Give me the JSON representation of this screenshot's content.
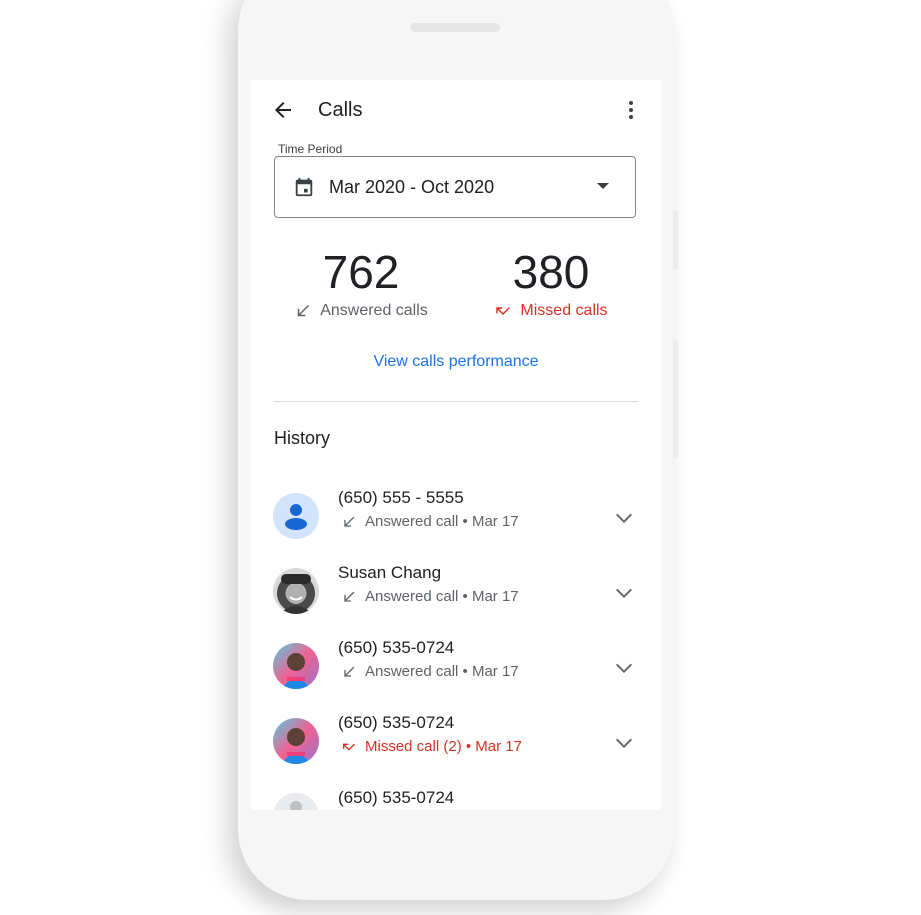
{
  "appbar": {
    "title": "Calls"
  },
  "time_period": {
    "label": "Time Period",
    "value": "Mar 2020 - Oct 2020"
  },
  "stats": {
    "answered": {
      "count": "762",
      "label": "Answered calls"
    },
    "missed": {
      "count": "380",
      "label": "Missed calls"
    }
  },
  "link": {
    "label": "View calls performance"
  },
  "history": {
    "title": "History",
    "items": [
      {
        "name": "(650) 555 - 5555",
        "status": "Answered call • Mar 17",
        "type": "answered",
        "avatar": "placeholder"
      },
      {
        "name": "Susan Chang",
        "status": "Answered call • Mar 17",
        "type": "answered",
        "avatar": "photo-grey"
      },
      {
        "name": "(650) 535-0724",
        "status": "Answered call • Mar 17",
        "type": "answered",
        "avatar": "photo-color"
      },
      {
        "name": "(650) 535-0724",
        "status": "Missed call (2) • Mar 17",
        "type": "missed",
        "avatar": "photo-color"
      },
      {
        "name": "(650) 535-0724",
        "status": "",
        "type": "partial",
        "avatar": "placeholder-grey"
      }
    ]
  },
  "colors": {
    "accent": "#1a73e8",
    "missed": "#d93025",
    "text": "#202124",
    "secondary": "#5f6368"
  }
}
